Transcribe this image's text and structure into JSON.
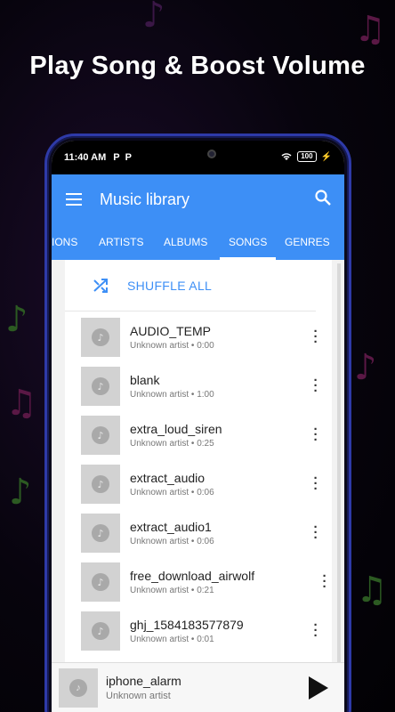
{
  "promo": {
    "headline": "Play Song & Boost Volume"
  },
  "statusbar": {
    "time": "11:40 AM",
    "p1": "P",
    "p2": "P",
    "battery": "100"
  },
  "appbar": {
    "title": "Music library"
  },
  "tabs": [
    {
      "label": "IONS"
    },
    {
      "label": "ARTISTS"
    },
    {
      "label": "ALBUMS"
    },
    {
      "label": "SONGS",
      "active": true
    },
    {
      "label": "GENRES"
    }
  ],
  "shuffle": {
    "label": "SHUFFLE ALL"
  },
  "songs": [
    {
      "title": "AUDIO_TEMP",
      "subtitle": "Unknown artist • 0:00"
    },
    {
      "title": "blank",
      "subtitle": "Unknown artist • 1:00"
    },
    {
      "title": "extra_loud_siren",
      "subtitle": "Unknown artist • 0:25"
    },
    {
      "title": "extract_audio",
      "subtitle": "Unknown artist • 0:06"
    },
    {
      "title": "extract_audio1",
      "subtitle": "Unknown artist • 0:06"
    },
    {
      "title": "free_download_airwolf",
      "subtitle": "Unknown artist • 0:21"
    },
    {
      "title": "ghj_1584183577879",
      "subtitle": "Unknown artist • 0:01"
    }
  ],
  "now_playing": {
    "title": "iphone_alarm",
    "subtitle": "Unknown artist"
  },
  "colors": {
    "accent": "#3d8ff6",
    "phone_frame": "#2e3aa8"
  }
}
